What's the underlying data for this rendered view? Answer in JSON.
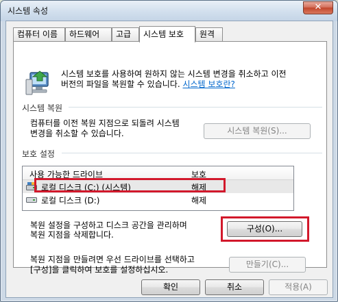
{
  "window": {
    "title": "시스템 속성",
    "close_label": "✕"
  },
  "tabs": [
    {
      "label": "컴퓨터 이름"
    },
    {
      "label": "하드웨어"
    },
    {
      "label": "고급"
    },
    {
      "label": "시스템 보호",
      "active": true
    },
    {
      "label": "원격"
    }
  ],
  "intro": {
    "line1": "시스템 보호를 사용하여 원하지 않는 시스템 변경을 취소하고 이전",
    "line2_prefix": "버전의 파일을 복원할 수 있습니다.",
    "link": "시스템 보호란?"
  },
  "restore": {
    "group_label": "시스템 복원",
    "line1": "컴퓨터를 이전 복원 지점으로 되돌려 시스템",
    "line2": "변경을 취소할 수 있습니다.",
    "button": "시스템 복원(S)..."
  },
  "protection": {
    "group_label": "보호 설정",
    "columns": {
      "drive": "사용 가능한 드라이브",
      "protection": "보호"
    },
    "drives": [
      {
        "name": "로컬 디스크 (C:) (시스템)",
        "status": "해제",
        "icon": "system-drive-icon"
      },
      {
        "name": "로컬 디스크 (D:)",
        "status": "해제",
        "icon": "drive-icon"
      }
    ],
    "configure": {
      "line1": "복원 설정을 구성하고 디스크 공간을 관리하며",
      "line2": "복원 지점을 삭제합니다.",
      "button": "구성(O)..."
    },
    "create": {
      "line1": "복원 지점을 만들려면 우선 드라이브를 선택하고",
      "line2": "[구성]을 클릭하여 보호를 설정하십시오.",
      "button": "만들기(C)..."
    }
  },
  "footer": {
    "ok": "확인",
    "cancel": "취소",
    "apply": "적용(A)"
  },
  "colors": {
    "highlight": "#d2182b",
    "link": "#0066cc"
  }
}
